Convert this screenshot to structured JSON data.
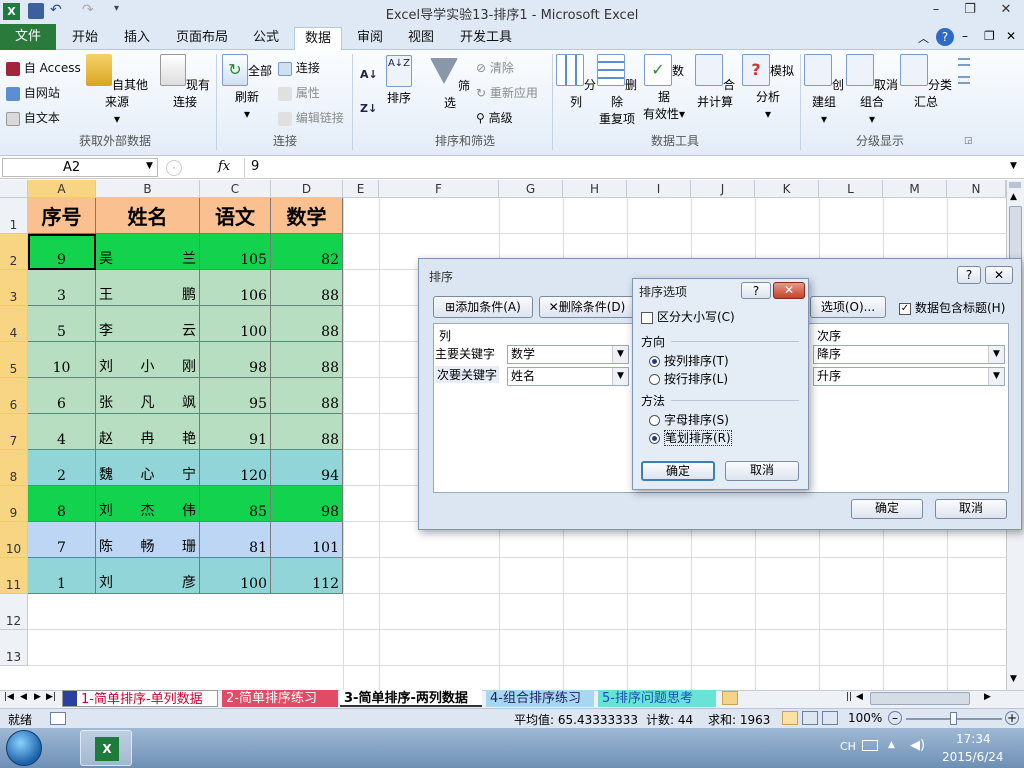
{
  "window": {
    "title": "Excel导学实验13-排序1 - Microsoft Excel"
  },
  "tabs": [
    "文件",
    "开始",
    "插入",
    "页面布局",
    "公式",
    "数据",
    "审阅",
    "视图",
    "开发工具"
  ],
  "ribbon": {
    "get_external": {
      "access": "自 Access",
      "web": "自网站",
      "text": "自文本",
      "other": "自其他来源",
      "existing": "现有连接",
      "group": "获取外部数据"
    },
    "connections": {
      "refresh_all": "全部刷新",
      "connections": "连接",
      "properties": "属性",
      "edit_links": "编辑链接",
      "group": "连接"
    },
    "sort_filter": {
      "az": "A↓Z",
      "sort": "排序",
      "filter": "筛选",
      "clear": "清除",
      "reapply": "重新应用",
      "advanced": "高级",
      "group": "排序和筛选"
    },
    "data_tools": {
      "split": "分列",
      "remove_dup_1": "删除",
      "remove_dup_2": "重复项",
      "validation_1": "数据",
      "validation_2": "有效性",
      "consolidate": "合并计算",
      "whatif": "模拟分析",
      "group": "数据工具"
    },
    "outline": {
      "group_btn": "创建组",
      "ungroup": "取消组合",
      "subtotal": "分类汇总",
      "group": "分级显示"
    }
  },
  "formula_bar": {
    "name_box": "A2",
    "fx": "fx",
    "value": "9"
  },
  "columns": [
    "A",
    "B",
    "C",
    "D",
    "E",
    "F",
    "G",
    "H",
    "I",
    "J",
    "K",
    "L",
    "M",
    "N"
  ],
  "rows": [
    "1",
    "2",
    "3",
    "4",
    "5",
    "6",
    "7",
    "8",
    "9",
    "10",
    "11",
    "12",
    "13"
  ],
  "table": {
    "header": [
      "序号",
      "姓名",
      "语文",
      "数学"
    ],
    "data": [
      {
        "no": "9",
        "n1": "吴",
        "n2": "",
        "n3": "兰",
        "yw": "105",
        "sx": "82"
      },
      {
        "no": "3",
        "n1": "王",
        "n2": "",
        "n3": "鹏",
        "yw": "106",
        "sx": "88"
      },
      {
        "no": "5",
        "n1": "李",
        "n2": "",
        "n3": "云",
        "yw": "100",
        "sx": "88"
      },
      {
        "no": "10",
        "n1": "刘",
        "n2": "小",
        "n3": "刚",
        "yw": "98",
        "sx": "88"
      },
      {
        "no": "6",
        "n1": "张",
        "n2": "凡",
        "n3": "飒",
        "yw": "95",
        "sx": "88"
      },
      {
        "no": "4",
        "n1": "赵",
        "n2": "冉",
        "n3": "艳",
        "yw": "91",
        "sx": "88"
      },
      {
        "no": "2",
        "n1": "魏",
        "n2": "心",
        "n3": "宁",
        "yw": "120",
        "sx": "94"
      },
      {
        "no": "8",
        "n1": "刘",
        "n2": "杰",
        "n3": "伟",
        "yw": "85",
        "sx": "98"
      },
      {
        "no": "7",
        "n1": "陈",
        "n2": "畅",
        "n3": "珊",
        "yw": "81",
        "sx": "101"
      },
      {
        "no": "1",
        "n1": "刘",
        "n2": "",
        "n3": "彦",
        "yw": "100",
        "sx": "112"
      }
    ]
  },
  "colors": {
    "header_fill": "#fac08f",
    "green": "#12d24e",
    "light_green": "#b7dec0",
    "teal": "#92d5d8",
    "light_blue": "#bcd6f4",
    "selected_header": "#f7d582",
    "file_tab": "#2a7a3b"
  },
  "sort_dialog": {
    "title": "排序",
    "add_condition": "添加条件(A)",
    "delete_condition": "删除条件(D)",
    "options": "选项(O)...",
    "has_header": "数据包含标题(H)",
    "col_header": "列",
    "order_header": "次序",
    "primary_label": "主要关键字",
    "secondary_label": "次要关键字",
    "primary_value": "数学",
    "secondary_value": "姓名",
    "order1": "降序",
    "order2": "升序",
    "ok": "确定",
    "cancel": "取消"
  },
  "options_dialog": {
    "title": "排序选项",
    "case_sensitive": "区分大小写(C)",
    "direction": "方向",
    "by_column": "按列排序(T)",
    "by_row": "按行排序(L)",
    "method": "方法",
    "alpha": "字母排序(S)",
    "stroke": "笔划排序(R)",
    "ok": "确定",
    "cancel": "取消"
  },
  "sheet_tabs": [
    "1-简单排序-单列数据",
    "2-简单排序练习",
    "3-简单排序-两列数据",
    "4-组合排序练习",
    "5-排序问题思考"
  ],
  "status": {
    "ready": "就绪",
    "average": "平均值: 65.43333333",
    "count": "计数: 44",
    "sum": "求和: 1963",
    "zoom": "100%"
  },
  "taskbar": {
    "lang": "CH",
    "time": "17:34",
    "date": "2015/6/24"
  }
}
